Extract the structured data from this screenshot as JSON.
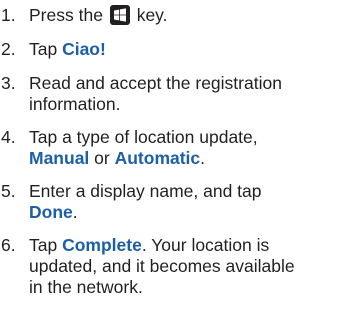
{
  "steps": [
    {
      "number": "1.",
      "before": "Press the",
      "after": "key.",
      "icon": "windows-key-icon"
    },
    {
      "number": "2.",
      "text": "Tap ",
      "keyword": "Ciao!",
      "after": ""
    },
    {
      "number": "3.",
      "line1": "Read and accept the registration",
      "line2": "information."
    },
    {
      "number": "4.",
      "line1": "Tap a type of location update,",
      "kw1": "Manual",
      "mid": " or ",
      "kw2": "Automatic",
      "end": "."
    },
    {
      "number": "5.",
      "line1": "Enter a display name, and tap",
      "kw": "Done",
      "end": "."
    },
    {
      "number": "6.",
      "pre": "Tap ",
      "kw": "Complete",
      "post": ". Your location is",
      "line2": "updated, and it becomes available",
      "line3": "in the network."
    }
  ],
  "colors": {
    "text": "#231f20",
    "keyword": "#1d5fa6"
  }
}
